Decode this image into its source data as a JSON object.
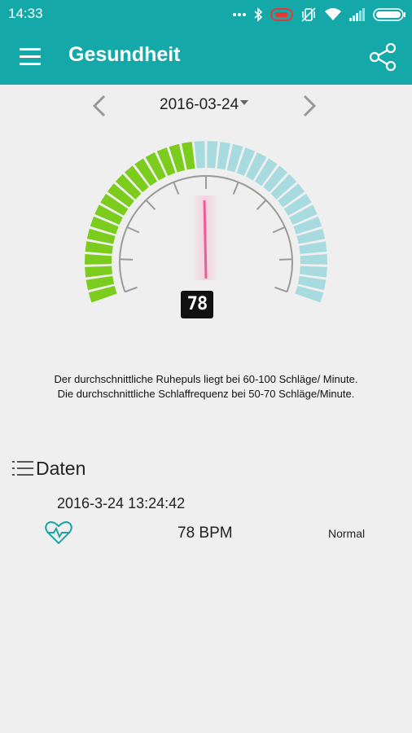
{
  "status_bar": {
    "time": "14:33",
    "icons": [
      "dots-icon",
      "bluetooth-icon",
      "record-icon",
      "vibrate-icon",
      "wifi-icon",
      "signal-icon",
      "battery-icon"
    ]
  },
  "app_bar": {
    "title": "Gesundheit",
    "menu_icon": "menu-icon",
    "share_icon": "share-icon",
    "color": "#15a8a8"
  },
  "date_nav": {
    "selected_date": "2016-03-24"
  },
  "gauge": {
    "value": "78",
    "low_color": "#7ccc1e",
    "high_color": "#a8dbe0",
    "needle_color": "#ee5c96"
  },
  "info_text": "Der durchschnittliche Ruhepuls liegt bei 60-100 Schläge/ Minute. Die durchschnittliche Schlaffrequenz bei 50-70 Schläge/Minute.",
  "data_section": {
    "title": "Daten",
    "records": [
      {
        "timestamp": "2016-3-24 13:24:42",
        "value": "78 BPM",
        "status": "Normal",
        "icon": "heart-rate-icon"
      }
    ]
  }
}
